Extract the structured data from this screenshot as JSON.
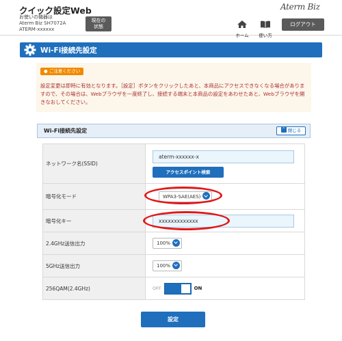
{
  "header": {
    "app_title": "クイック設定Web",
    "device_line1": "お使いの機器は",
    "device_line2": "Aterm Biz SH7072A",
    "device_line3": "ATERM-xxxxxx",
    "status_button_line1": "現在の",
    "status_button_line2": "状態",
    "brand": "Aterm Biz",
    "nav_home": "ホーム",
    "nav_help": "使い方",
    "logout": "ログアウト"
  },
  "page": {
    "title": "Wi-Fi接続先設定"
  },
  "notice": {
    "badge": "ご注意ください",
    "text": "設定変更は即時に有効となります。［設定］ボタンをクリックしたあと、本商品にアクセスできなくなる場合がありますので、その場合は、Webブラウザを一度終了し、接続する端末と本商品の設定をあわせたあと、Webブラウザを開きなおしてください。"
  },
  "section": {
    "title": "Wi-Fi接続先設定",
    "close_label": "閉じる"
  },
  "form": {
    "ssid": {
      "label": "ネットワーク名(SSID)",
      "value": "aterm-xxxxxx-x",
      "scan_button": "アクセスポイント検索"
    },
    "encryption": {
      "label": "暗号化モード",
      "value": "WPA3-SAE(AES)"
    },
    "key": {
      "label": "暗号化キー",
      "value": "xxxxxxxxxxxxx"
    },
    "power_24": {
      "label": "2.4GHz送信出力",
      "value": "100%"
    },
    "power_5": {
      "label": "5GHz送信出力",
      "value": "100%"
    },
    "qam": {
      "label": "256QAM(2.4GHz)",
      "off_label": "OFF",
      "on_label": "ON",
      "state": "on"
    }
  },
  "apply_button": "設定",
  "colors": {
    "accent": "#1f6fbd",
    "highlight": "#e01818",
    "notice_text": "#a83232",
    "badge": "#f08a00"
  },
  "icons": [
    "gear-icon",
    "home-icon",
    "book-icon",
    "chevron-down-icon",
    "chevron-up-icon"
  ]
}
